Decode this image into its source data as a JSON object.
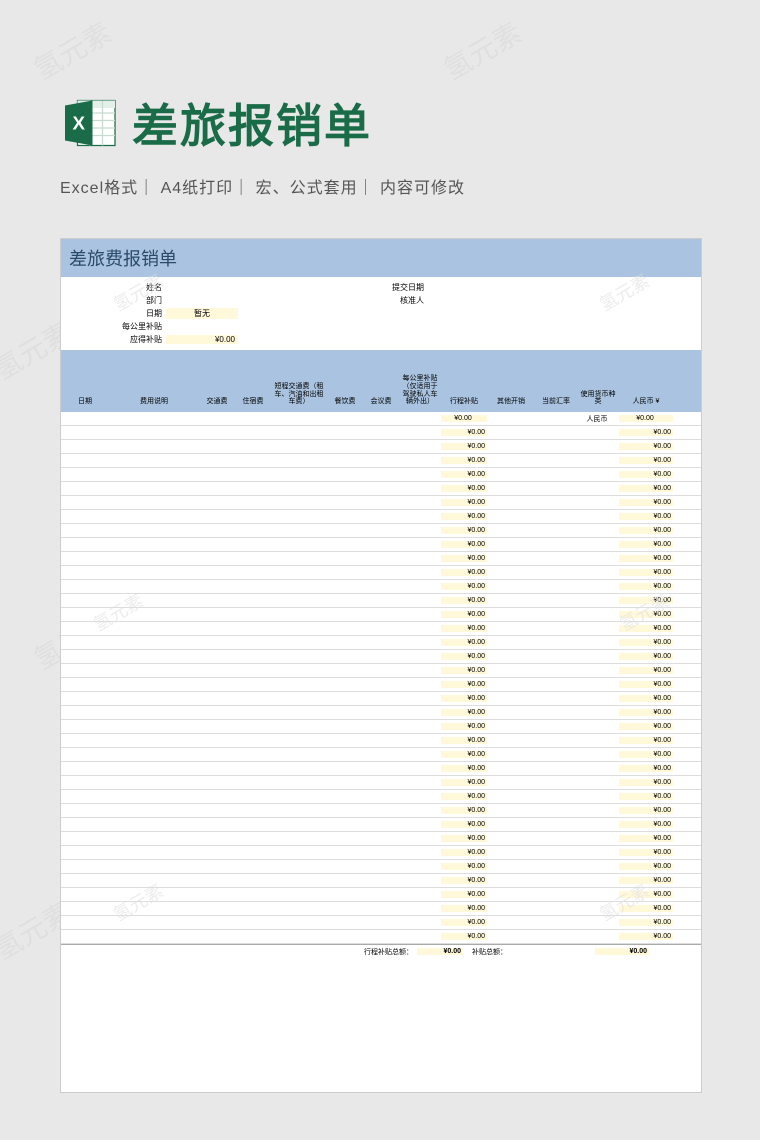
{
  "header": {
    "title": "差旅报销单",
    "subtitle": "Excel格式｜ A4纸打印｜ 宏、公式套用｜ 内容可修改"
  },
  "watermark": "氢元素",
  "form": {
    "title": "差旅费报销单",
    "labels": {
      "name": "姓名",
      "dept": "部门",
      "date": "日期",
      "submit_date": "提交日期",
      "approver": "核准人",
      "km_allowance": "每公里补贴",
      "reimbursable": "应得补贴"
    },
    "values": {
      "date": "暂无",
      "reimbursable": "¥0.00"
    },
    "columns": {
      "date": "日期",
      "desc": "费用说明",
      "transport": "交通费",
      "hotel": "住宿费",
      "short_trip": "短程交通费（租车、汽油和出租车费）",
      "meal": "餐饮费",
      "meeting": "会议费",
      "km_allow": "每公里补贴（仅适用于驾驶私人车辆外出）",
      "trip_allow": "行程补贴",
      "other": "其他开销",
      "rate": "当前汇率",
      "curr": "使用货币种类",
      "rmb": "人民币 ¥"
    },
    "currency_label": "人民币",
    "cell_value": "¥0.00",
    "row_count": 38,
    "totals": {
      "trip_label": "行程补贴总额：",
      "trip_value": "¥0.00",
      "allow_label": "补贴总额：",
      "rmb_value": "¥0.00"
    }
  }
}
